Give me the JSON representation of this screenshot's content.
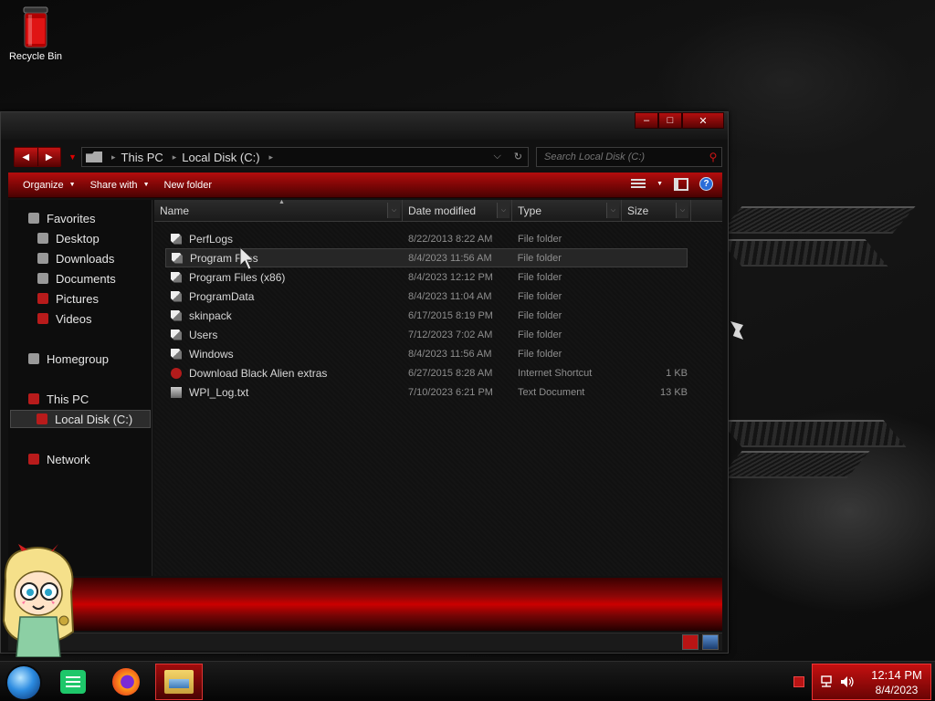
{
  "desktop": {
    "recycle_bin_label": "Recycle Bin"
  },
  "window": {
    "controls": {
      "minimize": "–",
      "maximize": "□",
      "close": "✕"
    },
    "nav": {
      "back": "◀",
      "forward": "▶",
      "recent": "▼"
    },
    "breadcrumb": [
      "This PC",
      "Local Disk (C:)"
    ],
    "breadcrumb_sep": "▸",
    "address_dropdown": "⌵",
    "refresh": "↻",
    "search_placeholder": "Search Local Disk (C:)",
    "search_icon": "⚲",
    "commands": [
      {
        "label": "Organize",
        "has_dropdown": true
      },
      {
        "label": "Share with",
        "has_dropdown": true
      },
      {
        "label": "New folder",
        "has_dropdown": false
      }
    ],
    "dropdown_arrow": "▼",
    "help_label": "?"
  },
  "navpane": {
    "favorites_label": "Favorites",
    "favorites": [
      "Desktop",
      "Downloads",
      "Documents",
      "Pictures",
      "Videos"
    ],
    "homegroup_label": "Homegroup",
    "this_pc_label": "This PC",
    "selected_item": "Local Disk (C:)",
    "network_label": "Network"
  },
  "columns": {
    "name": "Name",
    "date": "Date modified",
    "type": "Type",
    "size": "Size",
    "sort_indicator": "▲",
    "chevron": "⌵"
  },
  "files": [
    {
      "name": "PerfLogs",
      "date": "8/22/2013 8:22 AM",
      "type": "File folder",
      "size": "",
      "icon": "folder-icon"
    },
    {
      "name": "Program Files",
      "date": "8/4/2023 11:56 AM",
      "type": "File folder",
      "size": "",
      "icon": "folder-icon",
      "hovered": true
    },
    {
      "name": "Program Files (x86)",
      "date": "8/4/2023 12:12 PM",
      "type": "File folder",
      "size": "",
      "icon": "folder-icon"
    },
    {
      "name": "ProgramData",
      "date": "8/4/2023 11:04 AM",
      "type": "File folder",
      "size": "",
      "icon": "folder-icon"
    },
    {
      "name": "skinpack",
      "date": "6/17/2015 8:19 PM",
      "type": "File folder",
      "size": "",
      "icon": "folder-icon"
    },
    {
      "name": "Users",
      "date": "7/12/2023 7:02 AM",
      "type": "File folder",
      "size": "",
      "icon": "folder-icon"
    },
    {
      "name": "Windows",
      "date": "8/4/2023 11:56 AM",
      "type": "File folder",
      "size": "",
      "icon": "folder-icon"
    },
    {
      "name": "Download Black Alien extras",
      "date": "6/27/2015 8:28 AM",
      "type": "Internet Shortcut",
      "size": "1 KB",
      "icon": "internet-shortcut-icon"
    },
    {
      "name": "WPI_Log.txt",
      "date": "7/10/2023 6:21 PM",
      "type": "Text Document",
      "size": "13 KB",
      "icon": "text-document-icon"
    }
  ],
  "taskbar": {
    "clock_time": "12:14 PM",
    "clock_date": "8/4/2023"
  },
  "colors": {
    "accent_red": "#c41010",
    "dark_red": "#4a0202",
    "background": "#111111"
  }
}
